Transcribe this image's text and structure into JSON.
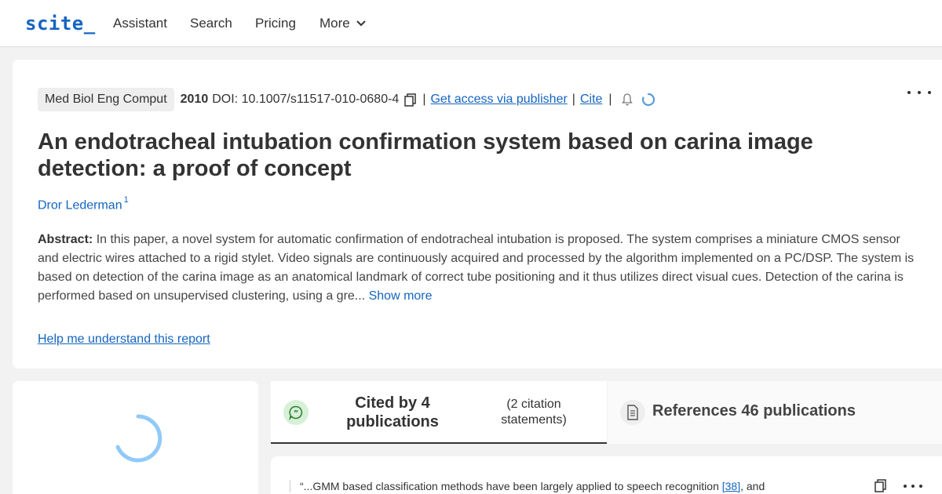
{
  "header": {
    "logo": "scite_",
    "nav": [
      "Assistant",
      "Search",
      "Pricing",
      "More"
    ]
  },
  "paper": {
    "journal": "Med Biol Eng Comput",
    "year": "2010",
    "doi": "DOI: 10.1007/s11517-010-0680-4",
    "access_link": "Get access via publisher",
    "cite_link": "Cite",
    "title": "An endotracheal intubation confirmation system based on carina image detection: a proof of concept",
    "author": "Dror Lederman",
    "author_affiliation": "1",
    "abstract_label": "Abstract:",
    "abstract_text": "In this paper, a novel system for automatic confirmation of endotracheal intubation is proposed. The system comprises a miniature CMOS sensor and electric wires attached to a rigid stylet. Video signals are continuously acquired and processed by the algorithm implemented on a PC/DSP. The system is based on detection of the carina image as an anatomical landmark of correct tube positioning and it thus utilizes direct visual cues. Detection of the carina is performed based on unsupervised clustering, using a gre...",
    "show_more": "Show more",
    "help_link": "Help me understand this report"
  },
  "tabs": {
    "cited_title": "Cited by 4 publications",
    "cited_sub": "(2 citation statements)",
    "refs_title": "References 46 publications"
  },
  "citation": {
    "quote_start": "“...GMM based classification methods have been largely applied to speech recognition ",
    "ref": "[38]",
    "quote_end": ", and"
  },
  "colors": {
    "accent": "#1565c0",
    "spinner": "#90caf9",
    "cite_icon_bg": "#d7f0d7",
    "cite_icon_fg": "#2e7d32"
  }
}
